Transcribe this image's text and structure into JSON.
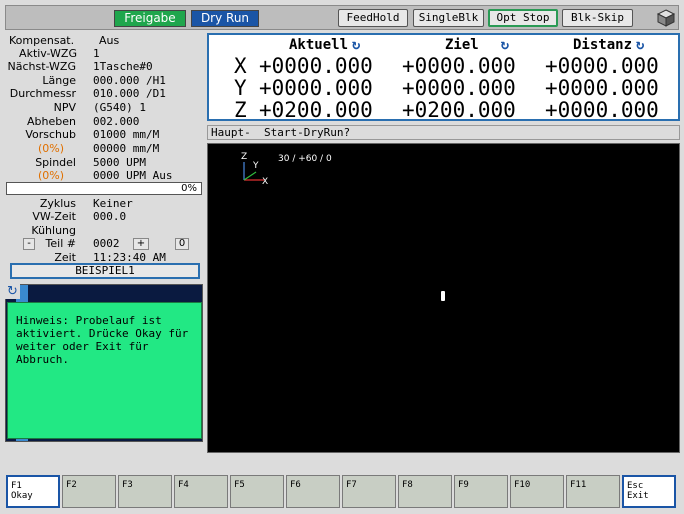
{
  "topbar": {
    "freigabe": "Freigabe",
    "dry_run": "Dry Run",
    "feedhold": "FeedHold",
    "singleblk": "SingleBlk",
    "opt_stop": "Opt Stop",
    "blk_skip": "Blk-Skip",
    "colors": {
      "freigabe": "#1fa64d",
      "dry_run": "#1a55a6"
    }
  },
  "info": {
    "kompensat_label": "Kompensat.",
    "kompensat_value": "Aus",
    "aktiv_wzg_label": "Aktiv-WZG",
    "aktiv_wzg_value": "1",
    "naechst_wzg_label": "Nächst-WZG",
    "naechst_wzg_value": "1Tasche#0",
    "laenge_label": "Länge",
    "laenge_value": "000.000 /H1",
    "durchmesser_label": "Durchmessr",
    "durchmesser_value": "010.000 /D1",
    "npv_label": "NPV",
    "npv_value": "(G540) 1",
    "abheben_label": "Abheben",
    "abheben_value": "002.000",
    "vorschub_label": "Vorschub",
    "vorschub_value": "01000 mm/M",
    "vorschub_pct": "(0%)",
    "vorschub_actual": "00000 mm/M",
    "spindel_label": "Spindel",
    "spindel_value": "5000 UPM",
    "spindel_pct": "(0%)",
    "spindel_actual": "0000 UPM Aus",
    "progress_text": "0%",
    "progress_value": 0,
    "zyklus_label": "Zyklus",
    "zyklus_value": "Keiner",
    "vw_zeit_label": "VW-Zeit",
    "vw_zeit_value": "000.0",
    "kuehlung_label": "Kühlung",
    "teil_minus": "-",
    "teil_label": "Teil #",
    "teil_value": "0002",
    "teil_plus": "+",
    "teil_reset": "0",
    "zeit_label": "Zeit",
    "zeit_value": "11:23:40 AM",
    "program_name": "BEISPIEL1"
  },
  "dro": {
    "col_aktuell": "Aktuell",
    "col_ziel": "Ziel",
    "col_distanz": "Distanz",
    "rows": [
      {
        "axis": "X",
        "aktuell": "+0000.000",
        "ziel": "+0000.000",
        "distanz": "+0000.000"
      },
      {
        "axis": "Y",
        "aktuell": "+0000.000",
        "ziel": "+0000.000",
        "distanz": "+0000.000"
      },
      {
        "axis": "Z",
        "aktuell": "+0200.000",
        "ziel": "+0200.000",
        "distanz": "+0000.000"
      }
    ]
  },
  "status_line": "Haupt-  Start-DryRun?",
  "graphic": {
    "coord_readout": "30 / +60 / 0",
    "axis_z": "Z",
    "axis_y": "Y",
    "axis_x": "X"
  },
  "popup": {
    "message": "Hinweis: Probelauf ist aktiviert. Drücke Okay für weiter oder Exit für Abbruch."
  },
  "fkeys": [
    {
      "key": "F1",
      "label": "Okay"
    },
    {
      "key": "F2",
      "label": ""
    },
    {
      "key": "F3",
      "label": ""
    },
    {
      "key": "F4",
      "label": ""
    },
    {
      "key": "F5",
      "label": ""
    },
    {
      "key": "F6",
      "label": ""
    },
    {
      "key": "F7",
      "label": ""
    },
    {
      "key": "F8",
      "label": ""
    },
    {
      "key": "F9",
      "label": ""
    },
    {
      "key": "F10",
      "label": ""
    },
    {
      "key": "F11",
      "label": ""
    },
    {
      "key": "Esc",
      "label": "Exit"
    }
  ]
}
